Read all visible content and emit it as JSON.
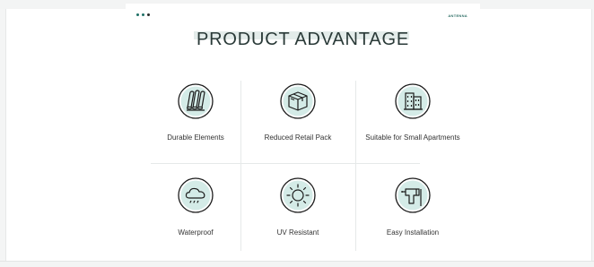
{
  "header": {
    "title": "PRODUCT ADVANTAGE",
    "brand": "ANTENNA"
  },
  "colors": {
    "accent": "#1e6f66",
    "icon_fill": "#d4ebe7",
    "icon_stroke": "#1c1c1c",
    "divider": "#e6e9e9"
  },
  "advantages": [
    {
      "label": "Durable Elements",
      "icon": "rolled-tubes-icon"
    },
    {
      "label": "Reduced Retail Pack",
      "icon": "package-box-icon"
    },
    {
      "label": "Suitable for Small Apartments",
      "icon": "apartment-building-icon"
    },
    {
      "label": "Waterproof",
      "icon": "rain-cloud-icon"
    },
    {
      "label": "UV Resistant",
      "icon": "sun-icon"
    },
    {
      "label": "Easy Installation",
      "icon": "power-drill-icon"
    }
  ]
}
